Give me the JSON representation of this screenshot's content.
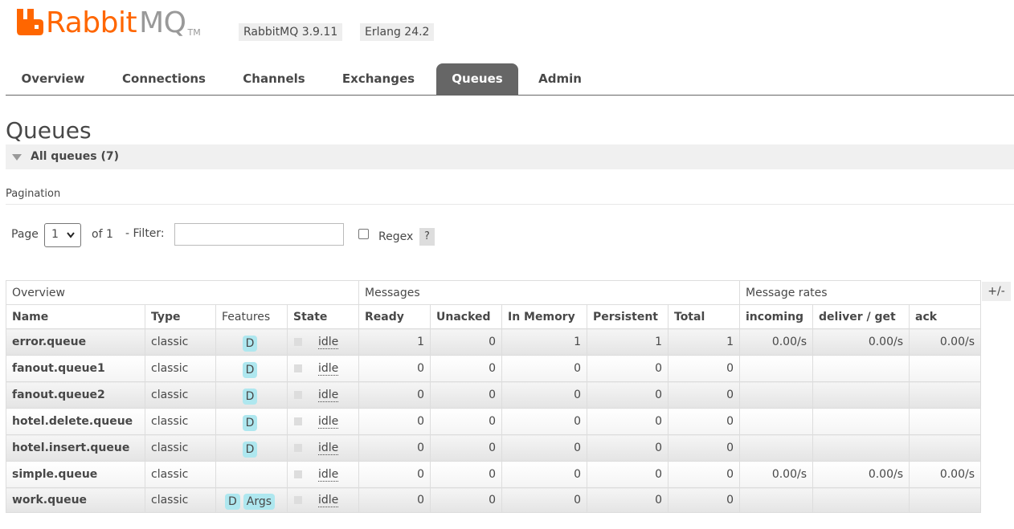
{
  "header": {
    "logo_rabbit": "Rabbit",
    "logo_mq": "MQ",
    "logo_tm": "TM",
    "version": "RabbitMQ 3.9.11",
    "erlang": "Erlang 24.2",
    "brand_color": "#ff6600"
  },
  "tabs": [
    {
      "label": "Overview"
    },
    {
      "label": "Connections"
    },
    {
      "label": "Channels"
    },
    {
      "label": "Exchanges"
    },
    {
      "label": "Queues",
      "active": true
    },
    {
      "label": "Admin"
    }
  ],
  "page": {
    "title": "Queues",
    "section": "All queues (7)"
  },
  "pagination": {
    "title": "Pagination",
    "page_label": "Page",
    "page_value": "1",
    "of_label": "of 1",
    "filter_label": "- Filter:",
    "filter_value": "",
    "regex_label": "Regex",
    "regex_checked": false,
    "help": "?"
  },
  "table": {
    "toggle": "+/-",
    "groups": [
      "Overview",
      "Messages",
      "Message rates"
    ],
    "columns": [
      "Name",
      "Type",
      "Features",
      "State",
      "Ready",
      "Unacked",
      "In Memory",
      "Persistent",
      "Total",
      "incoming",
      "deliver / get",
      "ack"
    ],
    "rows": [
      {
        "name": "error.queue",
        "type": "classic",
        "features": [
          "D"
        ],
        "state": "idle",
        "ready": "1",
        "unacked": "0",
        "in_memory": "1",
        "persistent": "1",
        "total": "1",
        "incoming": "0.00/s",
        "deliver_get": "0.00/s",
        "ack": "0.00/s"
      },
      {
        "name": "fanout.queue1",
        "type": "classic",
        "features": [
          "D"
        ],
        "state": "idle",
        "ready": "0",
        "unacked": "0",
        "in_memory": "0",
        "persistent": "0",
        "total": "0",
        "incoming": "",
        "deliver_get": "",
        "ack": ""
      },
      {
        "name": "fanout.queue2",
        "type": "classic",
        "features": [
          "D"
        ],
        "state": "idle",
        "ready": "0",
        "unacked": "0",
        "in_memory": "0",
        "persistent": "0",
        "total": "0",
        "incoming": "",
        "deliver_get": "",
        "ack": ""
      },
      {
        "name": "hotel.delete.queue",
        "type": "classic",
        "features": [
          "D"
        ],
        "state": "idle",
        "ready": "0",
        "unacked": "0",
        "in_memory": "0",
        "persistent": "0",
        "total": "0",
        "incoming": "",
        "deliver_get": "",
        "ack": ""
      },
      {
        "name": "hotel.insert.queue",
        "type": "classic",
        "features": [
          "D"
        ],
        "state": "idle",
        "ready": "0",
        "unacked": "0",
        "in_memory": "0",
        "persistent": "0",
        "total": "0",
        "incoming": "",
        "deliver_get": "",
        "ack": ""
      },
      {
        "name": "simple.queue",
        "type": "classic",
        "features": [],
        "state": "idle",
        "ready": "0",
        "unacked": "0",
        "in_memory": "0",
        "persistent": "0",
        "total": "0",
        "incoming": "0.00/s",
        "deliver_get": "0.00/s",
        "ack": "0.00/s"
      },
      {
        "name": "work.queue",
        "type": "classic",
        "features": [
          "D",
          "Args"
        ],
        "state": "idle",
        "ready": "0",
        "unacked": "0",
        "in_memory": "0",
        "persistent": "0",
        "total": "0",
        "incoming": "",
        "deliver_get": "",
        "ack": ""
      }
    ]
  }
}
